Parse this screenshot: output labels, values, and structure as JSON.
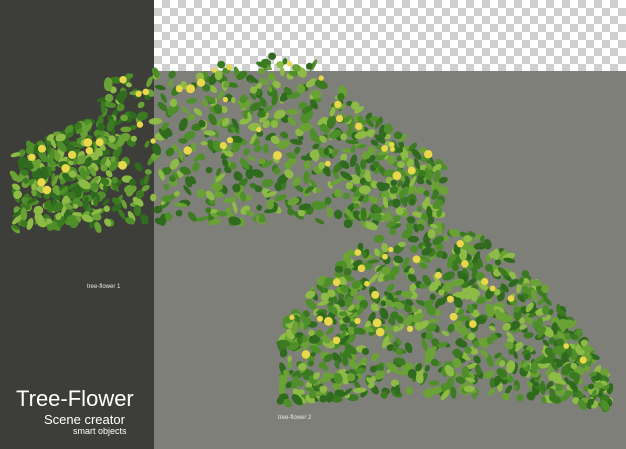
{
  "labels": {
    "flower1": "tree-flower 1",
    "flower2": "tree-flower 2"
  },
  "branding": {
    "title": "Tree-Flower",
    "subtitle": "Scene creator",
    "tagline": "smart objects"
  },
  "colors": {
    "dark_panel": "#3d3e3a",
    "gray_panel": "#7d7f78",
    "leaf_dark": "#2f6a1e",
    "leaf_mid": "#4f8f2a",
    "leaf_light": "#8dbb45",
    "flower": "#e8d84a"
  }
}
